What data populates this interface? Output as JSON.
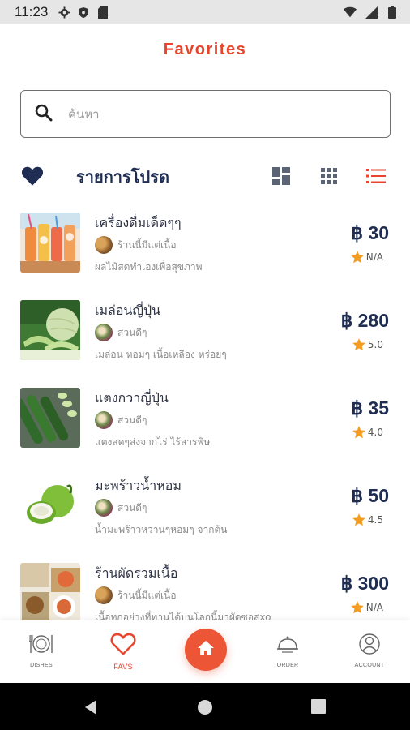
{
  "status_bar": {
    "time": "11:23"
  },
  "header": {
    "title": "Favorites"
  },
  "search": {
    "placeholder": "ค้นหา"
  },
  "section": {
    "title": "รายการโปรด"
  },
  "colors": {
    "accent": "#e8452c",
    "navy": "#1f2d52",
    "star": "#f39c1f"
  },
  "items": [
    {
      "name": "เครื่องดื่มเด็ดๆๆ",
      "store": "ร้านนี้มีแต่เนื้อ",
      "desc": "ผลไม้สดทำเองเพื่อสุขภาพ",
      "price": "฿ 30",
      "rating": "N/A"
    },
    {
      "name": "เมล่อนญี่ปุ่น",
      "store": "สวนดีๆ",
      "desc": "เมล่อน หอมๆ เนื้อเหลือง หร่อยๆ",
      "price": "฿ 280",
      "rating": "5.0"
    },
    {
      "name": "แตงกวาญี่ปุ่น",
      "store": "สวนดีๆ",
      "desc": "แตงสดๆส่งจากไร่ ไร้สารพิษ",
      "price": "฿ 35",
      "rating": "4.0"
    },
    {
      "name": "มะพร้าวน้ำหอม",
      "store": "สวนดีๆ",
      "desc": "น้ำมะพร้าวหวานๆหอมๆ จากต้น",
      "price": "฿ 50",
      "rating": "4.5"
    },
    {
      "name": "ร้านผัดรวมเนื้อ",
      "store": "ร้านนี้มีแต่เนื้อ",
      "desc": "เนื้อทุกอย่างที่ทานได้บนโลกนี้มาผัดซอสxo",
      "price": "฿ 300",
      "rating": "N/A"
    }
  ],
  "bottom_nav": {
    "dishes": "DISHES",
    "favs": "FAVS",
    "order": "ORDER",
    "account": "ACCOUNT"
  }
}
